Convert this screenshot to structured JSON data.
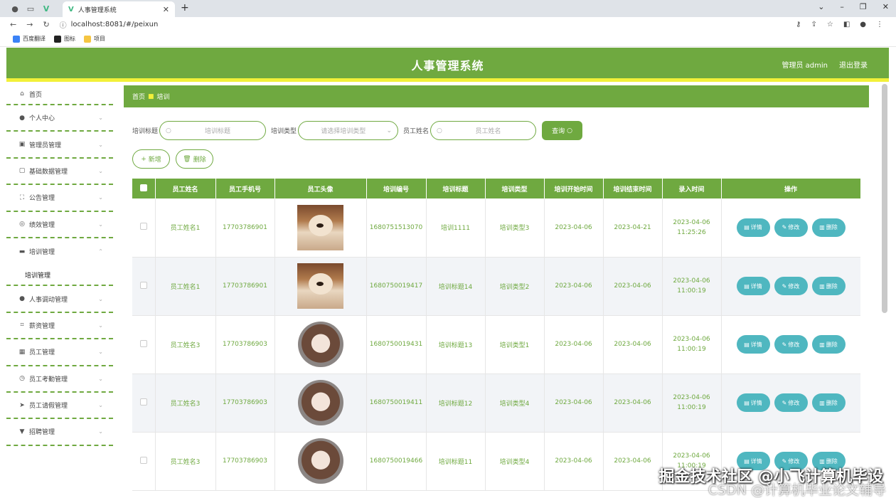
{
  "browser": {
    "tab_title": "人事管理系统",
    "url": "localhost:8081/#/peixun",
    "bookmarks": [
      "百度翻译",
      "图标",
      "项目"
    ]
  },
  "app": {
    "title": "人事管理系统",
    "user": "管理员 admin",
    "logout": "退出登录",
    "accent": "#6fa940",
    "header_stripe": "#f2f039",
    "op_button_color": "#4fb7c0"
  },
  "sidebar": {
    "home": "首页",
    "items": [
      {
        "label": "个人中心",
        "icon": "user-icon"
      },
      {
        "label": "管理员管理",
        "icon": "admin-icon"
      },
      {
        "label": "基础数据管理",
        "icon": "data-icon"
      },
      {
        "label": "公告管理",
        "icon": "notice-icon"
      },
      {
        "label": "绩效管理",
        "icon": "compass-icon"
      },
      {
        "label": "培训管理",
        "icon": "monitor-icon"
      },
      {
        "label": "人事调动管理",
        "icon": "person-icon"
      },
      {
        "label": "薪资管理",
        "icon": "crop-icon"
      },
      {
        "label": "员工管理",
        "icon": "keyboard-icon"
      },
      {
        "label": "员工考勤管理",
        "icon": "clock-icon"
      },
      {
        "label": "员工请假管理",
        "icon": "send-icon"
      },
      {
        "label": "招聘管理",
        "icon": "podium-icon"
      }
    ],
    "sub_item": "培训管理"
  },
  "breadcrumb": {
    "home": "首页",
    "current": "培训"
  },
  "search": {
    "title_label": "培训标题",
    "title_placeholder": "培训标题",
    "type_label": "培训类型",
    "type_placeholder": "请选择培训类型",
    "name_label": "员工姓名",
    "name_placeholder": "员工姓名",
    "query": "查询"
  },
  "actions": {
    "add": "新增",
    "delete": "删除"
  },
  "table": {
    "headers": [
      "员工姓名",
      "员工手机号",
      "员工头像",
      "培训编号",
      "培训标题",
      "培训类型",
      "培训开始时间",
      "培训结束时间",
      "录入时间",
      "操作"
    ],
    "ops": [
      "详情",
      "修改",
      "删除"
    ],
    "rows": [
      {
        "name": "员工姓名1",
        "phone": "17703786901",
        "avatar": "dog",
        "code": "1680751513070",
        "title": "培训1111",
        "type": "培训类型3",
        "start": "2023-04-06",
        "end": "2023-04-21",
        "created": "2023-04-06 11:25:26"
      },
      {
        "name": "员工姓名1",
        "phone": "17703786901",
        "avatar": "dog",
        "code": "1680750019417",
        "title": "培训标题14",
        "type": "培训类型2",
        "start": "2023-04-06",
        "end": "2023-04-06",
        "created": "2023-04-06 11:00:19"
      },
      {
        "name": "员工姓名3",
        "phone": "17703786903",
        "avatar": "girl",
        "code": "1680750019431",
        "title": "培训标题13",
        "type": "培训类型1",
        "start": "2023-04-06",
        "end": "2023-04-06",
        "created": "2023-04-06 11:00:19"
      },
      {
        "name": "员工姓名3",
        "phone": "17703786903",
        "avatar": "girl",
        "code": "1680750019411",
        "title": "培训标题12",
        "type": "培训类型4",
        "start": "2023-04-06",
        "end": "2023-04-06",
        "created": "2023-04-06 11:00:19"
      },
      {
        "name": "员工姓名3",
        "phone": "17703786903",
        "avatar": "girl",
        "code": "1680750019466",
        "title": "培训标题11",
        "type": "培训类型4",
        "start": "2023-04-06",
        "end": "2023-04-06",
        "created": "2023-04-06 11:00:19"
      }
    ]
  },
  "watermark": {
    "line1": "掘金技术社区 @小飞计算机毕设",
    "line2": "CSDN @计算机毕业论文辅导"
  }
}
